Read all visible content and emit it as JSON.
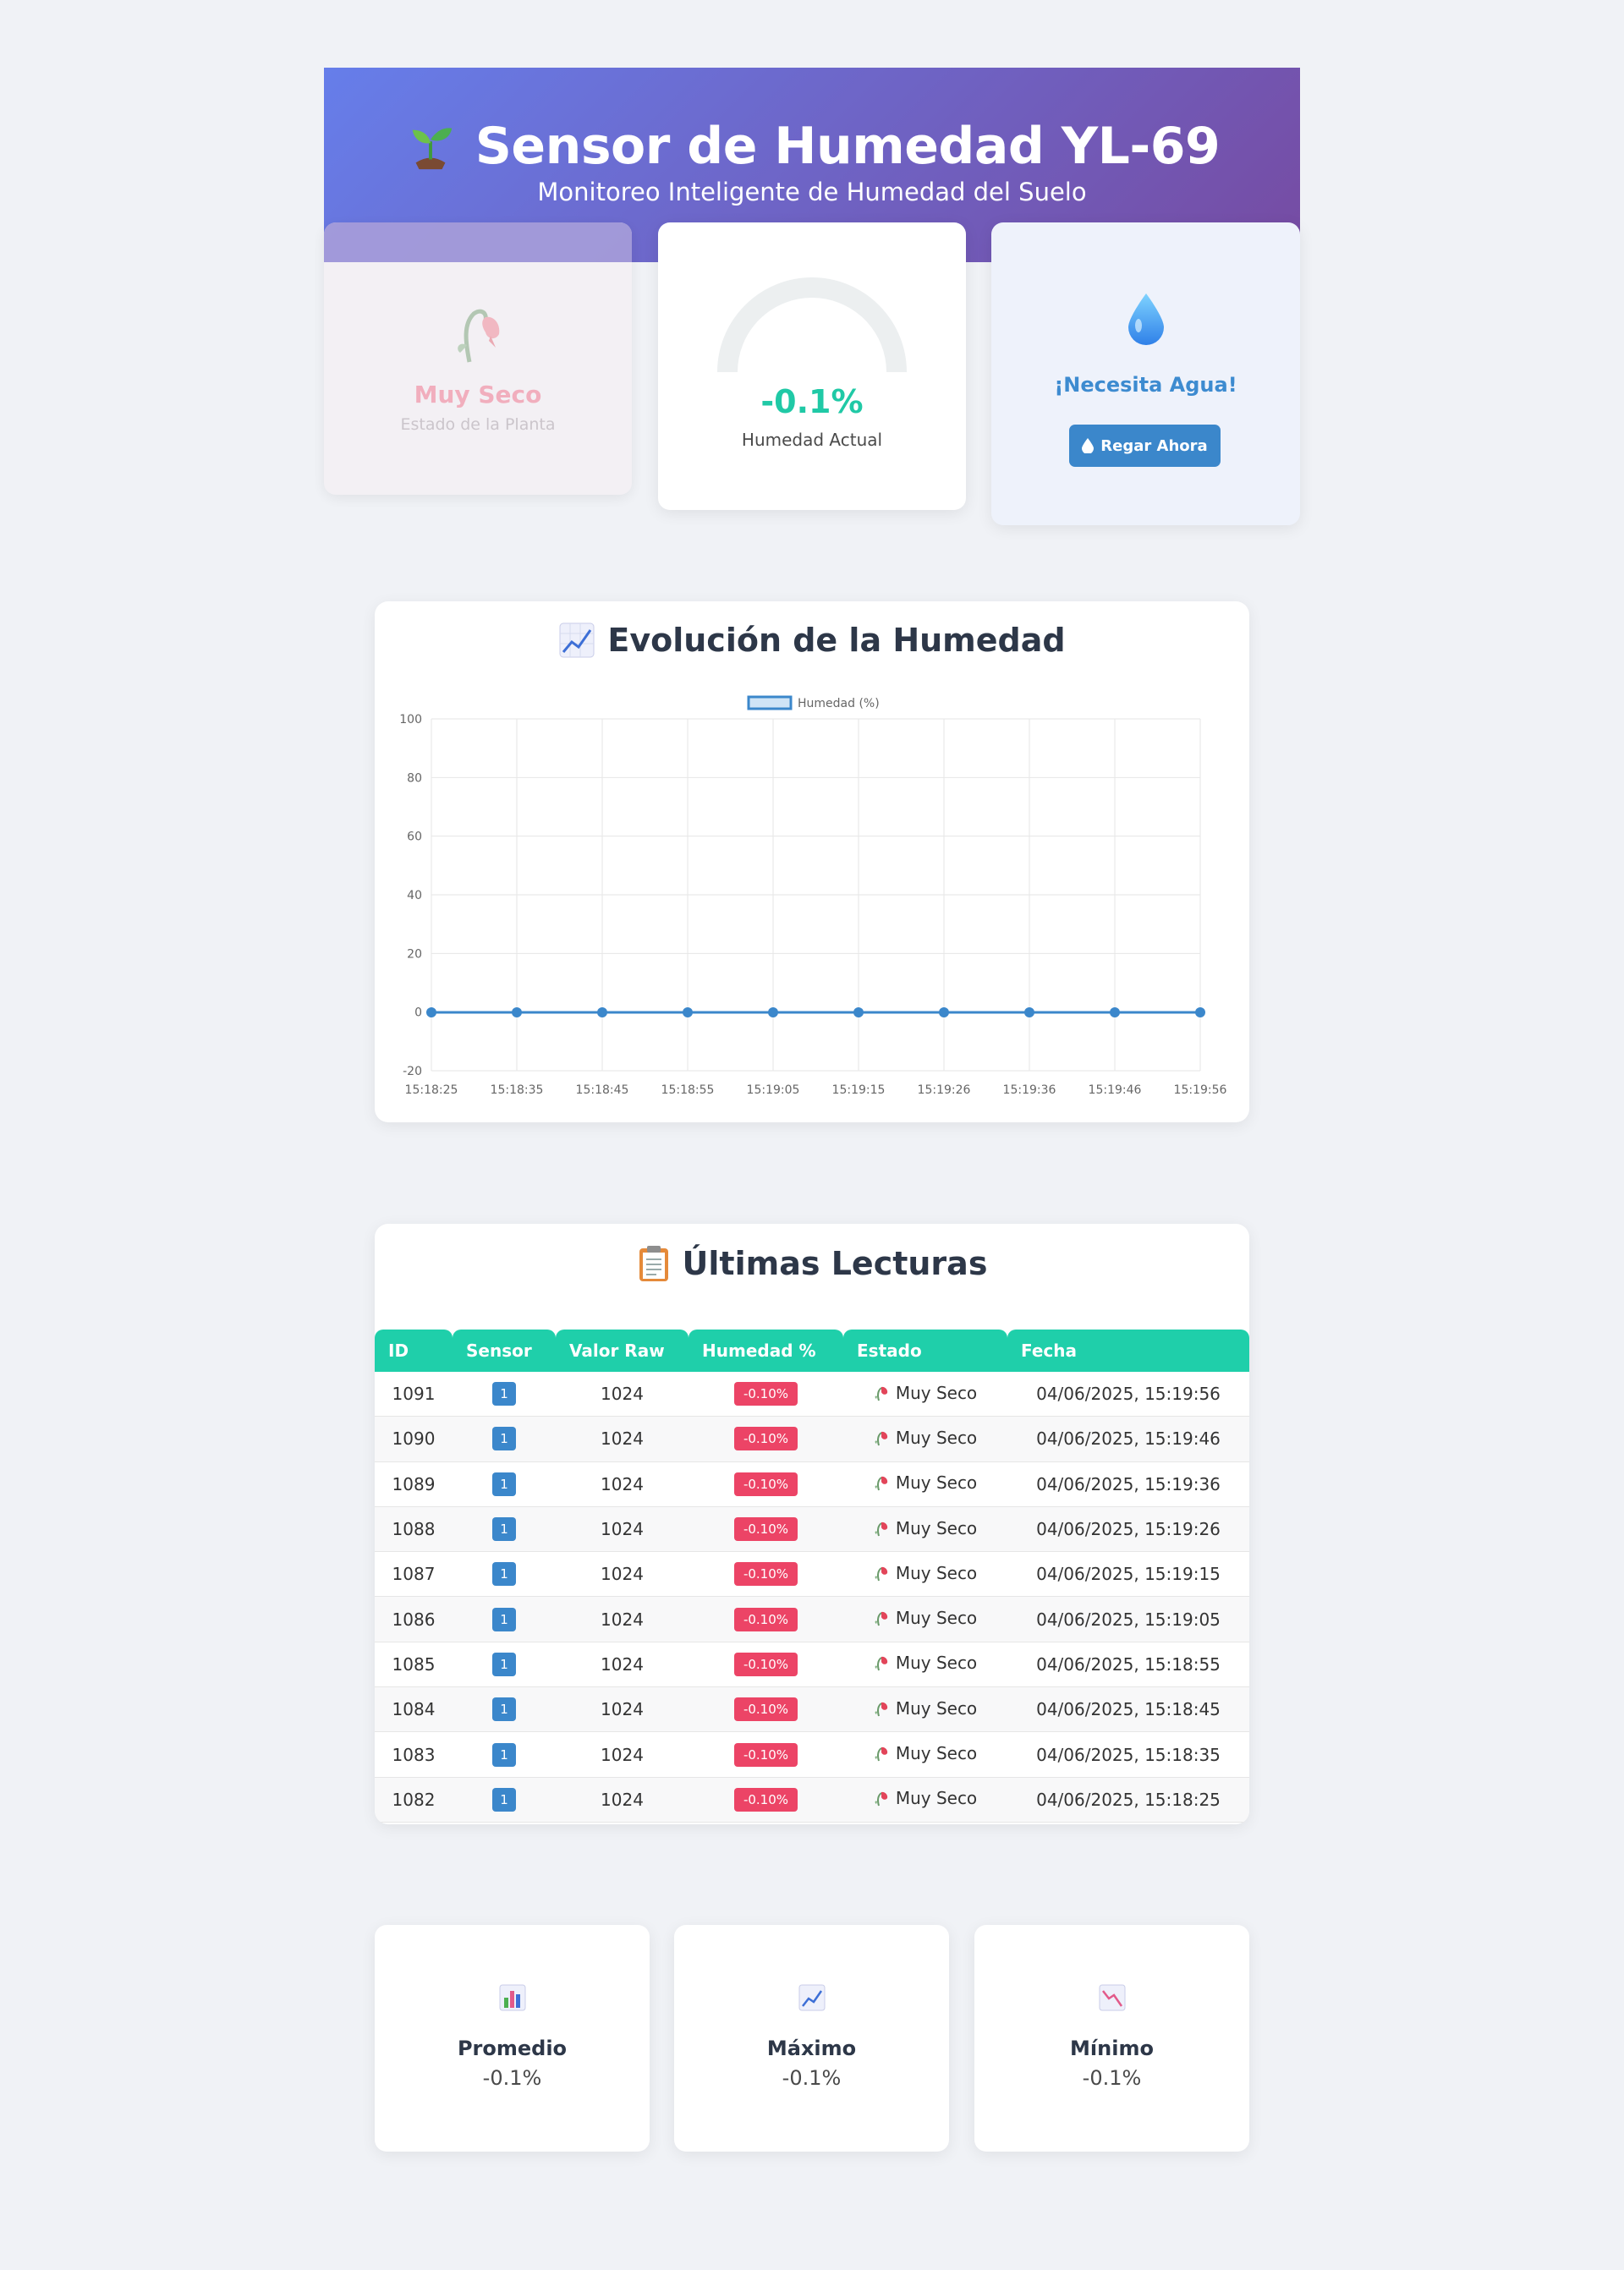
{
  "header": {
    "title": "Sensor de Humedad YL-69",
    "subtitle": "Monitoreo Inteligente de Humedad del Suelo",
    "icon": "seedling-icon"
  },
  "status_card": {
    "title": "Muy Seco",
    "subtitle": "Estado de la Planta",
    "icon": "wilted-flower-icon"
  },
  "gauge_card": {
    "value": "-0.1%",
    "label": "Humedad Actual",
    "level_percent": 0
  },
  "water_card": {
    "title": "¡Necesita Agua!",
    "button_label": "Regar Ahora",
    "icon": "droplet-icon"
  },
  "chart_panel": {
    "title": "Evolución de la Humedad",
    "icon": "chart-increasing-icon"
  },
  "chart_data": {
    "type": "line",
    "legend": "Humedad (%)",
    "x": [
      "15:18:25",
      "15:18:35",
      "15:18:45",
      "15:18:55",
      "15:19:05",
      "15:19:15",
      "15:19:26",
      "15:19:36",
      "15:19:46",
      "15:19:56"
    ],
    "series": [
      {
        "name": "Humedad (%)",
        "values": [
          -0.1,
          -0.1,
          -0.1,
          -0.1,
          -0.1,
          -0.1,
          -0.1,
          -0.1,
          -0.1,
          -0.1
        ]
      }
    ],
    "ylim": [
      -20,
      100
    ],
    "yticks": [
      "100",
      "80",
      "60",
      "40",
      "20",
      "0",
      "-20"
    ],
    "grid": true,
    "legend_position": "top",
    "color": "#3b87cb"
  },
  "table_panel": {
    "title": "Últimas Lecturas",
    "icon": "clipboard-icon",
    "headers": [
      "ID",
      "Sensor",
      "Valor Raw",
      "Humedad %",
      "Estado",
      "Fecha"
    ],
    "rows": [
      {
        "id": "1091",
        "sensor": "1",
        "raw": "1024",
        "hum": "-0.10%",
        "estado": "Muy Seco",
        "fecha": "04/06/2025, 15:19:56"
      },
      {
        "id": "1090",
        "sensor": "1",
        "raw": "1024",
        "hum": "-0.10%",
        "estado": "Muy Seco",
        "fecha": "04/06/2025, 15:19:46"
      },
      {
        "id": "1089",
        "sensor": "1",
        "raw": "1024",
        "hum": "-0.10%",
        "estado": "Muy Seco",
        "fecha": "04/06/2025, 15:19:36"
      },
      {
        "id": "1088",
        "sensor": "1",
        "raw": "1024",
        "hum": "-0.10%",
        "estado": "Muy Seco",
        "fecha": "04/06/2025, 15:19:26"
      },
      {
        "id": "1087",
        "sensor": "1",
        "raw": "1024",
        "hum": "-0.10%",
        "estado": "Muy Seco",
        "fecha": "04/06/2025, 15:19:15"
      },
      {
        "id": "1086",
        "sensor": "1",
        "raw": "1024",
        "hum": "-0.10%",
        "estado": "Muy Seco",
        "fecha": "04/06/2025, 15:19:05"
      },
      {
        "id": "1085",
        "sensor": "1",
        "raw": "1024",
        "hum": "-0.10%",
        "estado": "Muy Seco",
        "fecha": "04/06/2025, 15:18:55"
      },
      {
        "id": "1084",
        "sensor": "1",
        "raw": "1024",
        "hum": "-0.10%",
        "estado": "Muy Seco",
        "fecha": "04/06/2025, 15:18:45"
      },
      {
        "id": "1083",
        "sensor": "1",
        "raw": "1024",
        "hum": "-0.10%",
        "estado": "Muy Seco",
        "fecha": "04/06/2025, 15:18:35"
      },
      {
        "id": "1082",
        "sensor": "1",
        "raw": "1024",
        "hum": "-0.10%",
        "estado": "Muy Seco",
        "fecha": "04/06/2025, 15:18:25"
      }
    ]
  },
  "stats": [
    {
      "label": "Promedio",
      "value": "-0.1%",
      "icon": "bar-chart-icon"
    },
    {
      "label": "Máximo",
      "value": "-0.1%",
      "icon": "chart-increasing-icon"
    },
    {
      "label": "Mínimo",
      "value": "-0.1%",
      "icon": "chart-decreasing-icon"
    }
  ],
  "colors": {
    "header_gradient_start": "#667eea",
    "header_gradient_end": "#764ba2",
    "accent_teal": "#1fcfaa",
    "accent_blue": "#3b87cb",
    "alert_red": "#ec4466"
  }
}
